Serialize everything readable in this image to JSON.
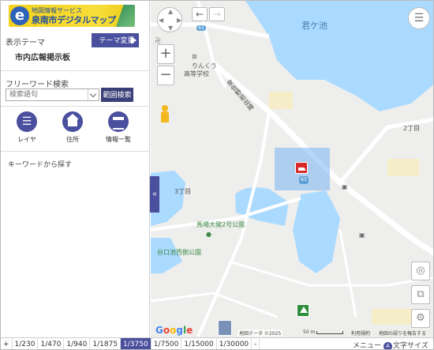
{
  "logo": {
    "sub": "地図情報サービス",
    "main": "泉南市デジタルマップ",
    "mark": "e"
  },
  "theme": {
    "label": "表示テーマ",
    "change_button": "テーマ変更",
    "current": "市内広報掲示板"
  },
  "freeword": {
    "label": "フリーワード検索",
    "placeholder": "検索語句",
    "range_button": "範囲検索"
  },
  "tools": [
    {
      "label": "レイヤ",
      "icon": "layers-list-icon"
    },
    {
      "label": "住所",
      "icon": "house-icon"
    },
    {
      "label": "情報一覧",
      "icon": "list-table-icon"
    }
  ],
  "keyword_search": "キーワードから探す",
  "collapse_button": "«",
  "map": {
    "pond_name": "君ケ池",
    "street": "泉佐野岩出線",
    "school_1": "りんくう",
    "school_2": "高等学校",
    "route": "63",
    "chome_2": "2丁目",
    "chome_3": "3丁目",
    "park_1": "馬場大発2号公園",
    "park_2": "谷口池西側公園",
    "map_symbol": "卍",
    "google": [
      "G",
      "o",
      "o",
      "g",
      "l",
      "e"
    ],
    "attribution": "地図データ ©2025",
    "scale_label": "50 m",
    "terms": "利用規約",
    "report": "地図の誤りを報告する"
  },
  "controls": {
    "back": "←",
    "forward": "→",
    "zoom_in": "+",
    "zoom_out": "−",
    "menu": "☰",
    "locate": "◎",
    "copy": "⧉",
    "settings": "⚙"
  },
  "scales": {
    "plus": "+",
    "items": [
      "1/230",
      "1/470",
      "1/940",
      "1/1875",
      "1/3750",
      "1/7500",
      "1/15000",
      "1/30000"
    ],
    "active": "1/3750",
    "minus": "-"
  },
  "footer": {
    "menu": "メニュー",
    "text_size": "文字サイズ",
    "text_size_icon": "A"
  },
  "colors": {
    "accent": "#4a4f9e",
    "water": "#aadaff",
    "park": "#2d8d3a",
    "marker": "#d72a2a"
  }
}
